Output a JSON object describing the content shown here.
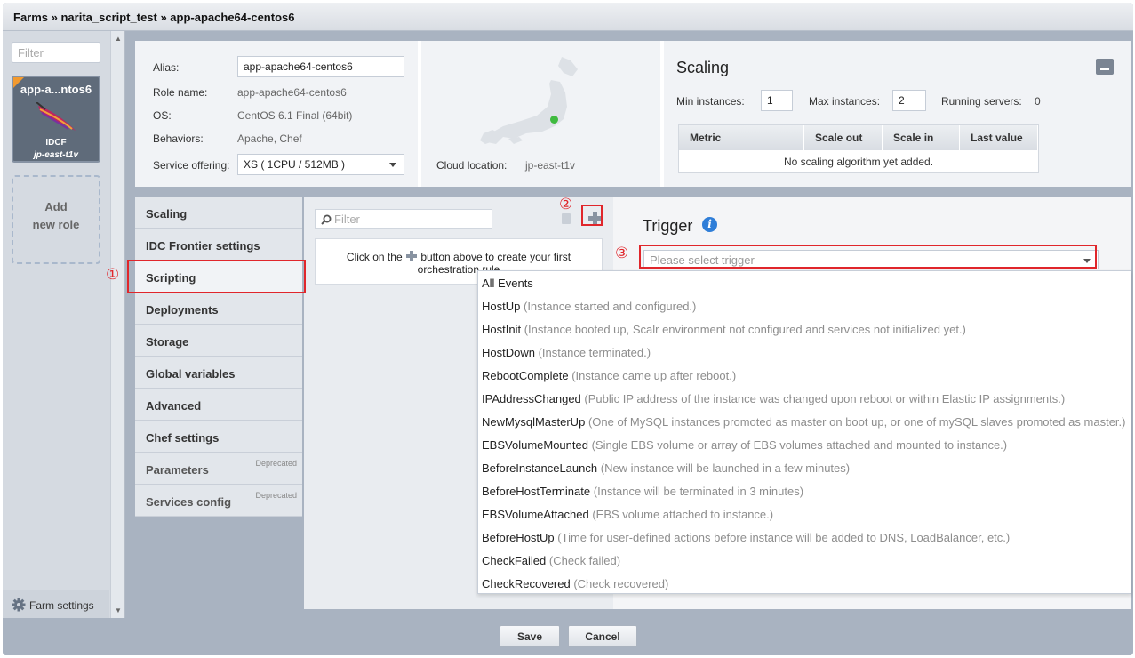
{
  "breadcrumb": "Farms » narita_script_test » app-apache64-centos6",
  "sidebar": {
    "filter_placeholder": "Filter",
    "role_tile": {
      "name": "app-a...ntos6",
      "cloud": "IDCF",
      "location": "jp-east-t1v"
    },
    "add_role_line1": "Add",
    "add_role_line2": "new role",
    "farm_settings": "Farm settings"
  },
  "role_info": {
    "alias_label": "Alias:",
    "alias_value": "app-apache64-centos6",
    "role_name_label": "Role name:",
    "role_name_value": "app-apache64-centos6",
    "os_label": "OS:",
    "os_value": "CentOS 6.1 Final (64bit)",
    "behaviors_label": "Behaviors:",
    "behaviors_value": "Apache, Chef",
    "service_offering_label": "Service offering:",
    "service_offering_value": "XS ( 1CPU / 512MB )",
    "cloud_location_label": "Cloud location:",
    "cloud_location_value": "jp-east-t1v"
  },
  "scaling_panel": {
    "title": "Scaling",
    "min_label": "Min instances:",
    "min_value": "1",
    "max_label": "Max instances:",
    "max_value": "2",
    "running_label": "Running servers:",
    "running_value": "0",
    "columns": [
      "Metric",
      "Scale out",
      "Scale in",
      "Last value"
    ],
    "empty_text": "No scaling algorithm yet added."
  },
  "tabs": [
    {
      "label": "Scaling"
    },
    {
      "label": "IDC Frontier settings"
    },
    {
      "label": "Scripting"
    },
    {
      "label": "Deployments"
    },
    {
      "label": "Storage"
    },
    {
      "label": "Global variables"
    },
    {
      "label": "Advanced"
    },
    {
      "label": "Chef settings"
    },
    {
      "label": "Parameters",
      "badge": "Deprecated"
    },
    {
      "label": "Services config",
      "badge": "Deprecated"
    }
  ],
  "rules": {
    "filter_placeholder": "Filter",
    "hint_before": "Click on the",
    "hint_after": "button above to create your first",
    "hint_line2": "orchestration rule"
  },
  "trigger": {
    "title": "Trigger",
    "placeholder": "Please select trigger",
    "options": [
      {
        "name": "All Events",
        "desc": ""
      },
      {
        "name": "HostUp",
        "desc": "(Instance started and configured.)"
      },
      {
        "name": "HostInit",
        "desc": "(Instance booted up, Scalr environment not configured and services not initialized yet.)"
      },
      {
        "name": "HostDown",
        "desc": "(Instance terminated.)"
      },
      {
        "name": "RebootComplete",
        "desc": "(Instance came up after reboot.)"
      },
      {
        "name": "IPAddressChanged",
        "desc": "(Public IP address of the instance was changed upon reboot or within Elastic IP assignments.)"
      },
      {
        "name": "NewMysqlMasterUp",
        "desc": "(One of MySQL instances promoted as master on boot up, or one of mySQL slaves promoted as master.)"
      },
      {
        "name": "EBSVolumeMounted",
        "desc": "(Single EBS volume or array of EBS volumes attached and mounted to instance.)"
      },
      {
        "name": "BeforeInstanceLaunch",
        "desc": "(New instance will be launched in a few minutes)"
      },
      {
        "name": "BeforeHostTerminate",
        "desc": "(Instance will be terminated in 3 minutes)"
      },
      {
        "name": "EBSVolumeAttached",
        "desc": "(EBS volume attached to instance.)"
      },
      {
        "name": "BeforeHostUp",
        "desc": "(Time for user-defined actions before instance will be added to DNS, LoadBalancer, etc.)"
      },
      {
        "name": "CheckFailed",
        "desc": "(Check failed)"
      },
      {
        "name": "CheckRecovered",
        "desc": "(Check recovered)"
      }
    ]
  },
  "annotations": {
    "one": "①",
    "two": "②",
    "three": "③"
  },
  "footer": {
    "save": "Save",
    "cancel": "Cancel"
  },
  "colors": {
    "highlight": "#e0262b",
    "accent": "#2f7ed8",
    "status_dot": "#3fba3f"
  }
}
